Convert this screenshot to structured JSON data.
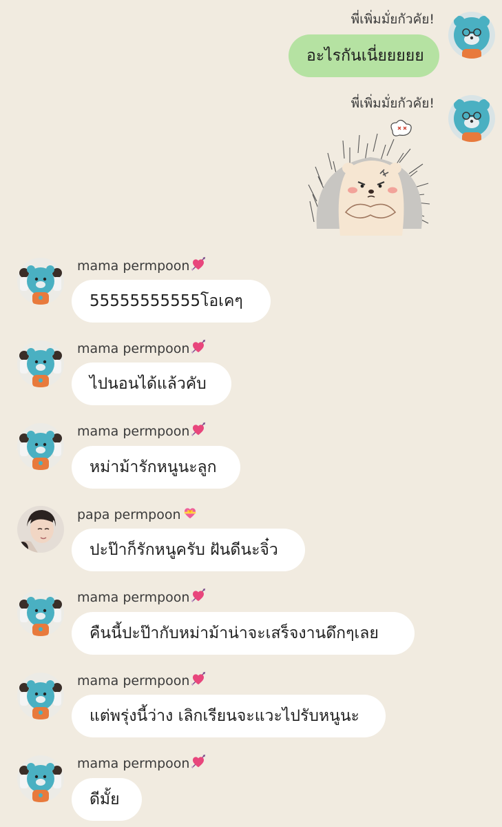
{
  "conversation": {
    "outgoing": [
      {
        "sender": "พี่เพิ่มมั่ยกัวคัย!",
        "text": "อะไรกันเนี่ยยยยย"
      },
      {
        "sender": "พี่เพิ่มมั่ยกัวคัย!",
        "sticker": "hedgehog-grumpy-sticker"
      }
    ],
    "incoming": [
      {
        "sender": "mama permpoon",
        "heart": "heart-arrow-icon",
        "text": "55555555555โอเคๆ"
      },
      {
        "sender": "mama permpoon",
        "heart": "heart-arrow-icon",
        "text": "ไปนอนได้แล้วคับ"
      },
      {
        "sender": "mama permpoon",
        "heart": "heart-arrow-icon",
        "text": "หม่าม้ารักหนูนะลูก"
      },
      {
        "sender": "papa permpoon",
        "heart": "heart-ribbon-icon",
        "text": "ปะป๊าก็รักหนูครับ ฝันดีนะจิ๋ว"
      },
      {
        "sender": "mama permpoon",
        "heart": "heart-arrow-icon",
        "text": "คืนนี้ปะป๊ากับหม่าม้าน่าจะเสร็จงานดึกๆเลย"
      },
      {
        "sender": "mama permpoon",
        "heart": "heart-arrow-icon",
        "text": "แต่พรุ่งนี้ว่าง เลิกเรียนจะแวะไปรับหนูนะ"
      },
      {
        "sender": "mama permpoon",
        "heart": "heart-arrow-icon",
        "text": "ดีมั้ย"
      }
    ]
  },
  "colors": {
    "background": "#f1ebe0",
    "incoming_bubble": "#ffffff",
    "outgoing_bubble": "#b5e2a2",
    "heart_pink": "#e8467c"
  }
}
